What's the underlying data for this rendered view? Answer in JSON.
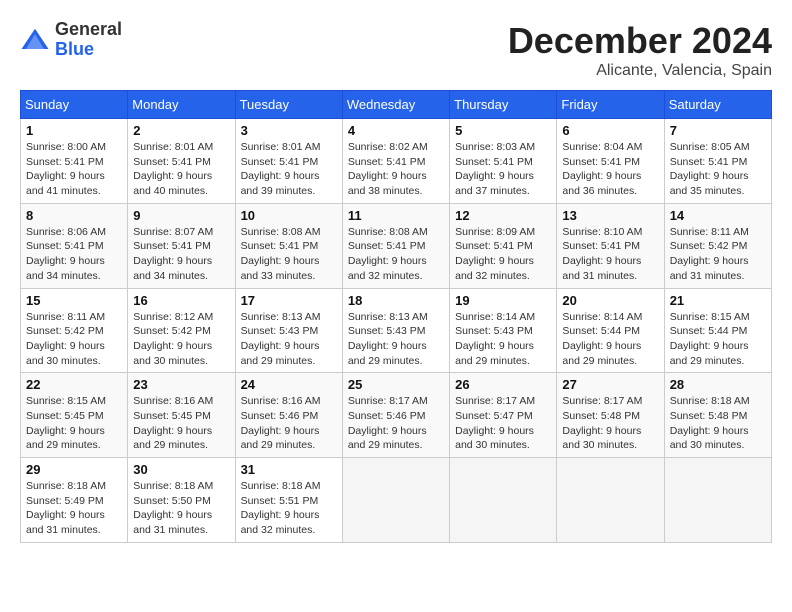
{
  "header": {
    "logo_general": "General",
    "logo_blue": "Blue",
    "month_title": "December 2024",
    "location": "Alicante, Valencia, Spain"
  },
  "calendar": {
    "days_of_week": [
      "Sunday",
      "Monday",
      "Tuesday",
      "Wednesday",
      "Thursday",
      "Friday",
      "Saturday"
    ],
    "weeks": [
      [
        {
          "day": "1",
          "sunrise": "Sunrise: 8:00 AM",
          "sunset": "Sunset: 5:41 PM",
          "daylight": "Daylight: 9 hours and 41 minutes."
        },
        {
          "day": "2",
          "sunrise": "Sunrise: 8:01 AM",
          "sunset": "Sunset: 5:41 PM",
          "daylight": "Daylight: 9 hours and 40 minutes."
        },
        {
          "day": "3",
          "sunrise": "Sunrise: 8:01 AM",
          "sunset": "Sunset: 5:41 PM",
          "daylight": "Daylight: 9 hours and 39 minutes."
        },
        {
          "day": "4",
          "sunrise": "Sunrise: 8:02 AM",
          "sunset": "Sunset: 5:41 PM",
          "daylight": "Daylight: 9 hours and 38 minutes."
        },
        {
          "day": "5",
          "sunrise": "Sunrise: 8:03 AM",
          "sunset": "Sunset: 5:41 PM",
          "daylight": "Daylight: 9 hours and 37 minutes."
        },
        {
          "day": "6",
          "sunrise": "Sunrise: 8:04 AM",
          "sunset": "Sunset: 5:41 PM",
          "daylight": "Daylight: 9 hours and 36 minutes."
        },
        {
          "day": "7",
          "sunrise": "Sunrise: 8:05 AM",
          "sunset": "Sunset: 5:41 PM",
          "daylight": "Daylight: 9 hours and 35 minutes."
        }
      ],
      [
        {
          "day": "8",
          "sunrise": "Sunrise: 8:06 AM",
          "sunset": "Sunset: 5:41 PM",
          "daylight": "Daylight: 9 hours and 34 minutes."
        },
        {
          "day": "9",
          "sunrise": "Sunrise: 8:07 AM",
          "sunset": "Sunset: 5:41 PM",
          "daylight": "Daylight: 9 hours and 34 minutes."
        },
        {
          "day": "10",
          "sunrise": "Sunrise: 8:08 AM",
          "sunset": "Sunset: 5:41 PM",
          "daylight": "Daylight: 9 hours and 33 minutes."
        },
        {
          "day": "11",
          "sunrise": "Sunrise: 8:08 AM",
          "sunset": "Sunset: 5:41 PM",
          "daylight": "Daylight: 9 hours and 32 minutes."
        },
        {
          "day": "12",
          "sunrise": "Sunrise: 8:09 AM",
          "sunset": "Sunset: 5:41 PM",
          "daylight": "Daylight: 9 hours and 32 minutes."
        },
        {
          "day": "13",
          "sunrise": "Sunrise: 8:10 AM",
          "sunset": "Sunset: 5:41 PM",
          "daylight": "Daylight: 9 hours and 31 minutes."
        },
        {
          "day": "14",
          "sunrise": "Sunrise: 8:11 AM",
          "sunset": "Sunset: 5:42 PM",
          "daylight": "Daylight: 9 hours and 31 minutes."
        }
      ],
      [
        {
          "day": "15",
          "sunrise": "Sunrise: 8:11 AM",
          "sunset": "Sunset: 5:42 PM",
          "daylight": "Daylight: 9 hours and 30 minutes."
        },
        {
          "day": "16",
          "sunrise": "Sunrise: 8:12 AM",
          "sunset": "Sunset: 5:42 PM",
          "daylight": "Daylight: 9 hours and 30 minutes."
        },
        {
          "day": "17",
          "sunrise": "Sunrise: 8:13 AM",
          "sunset": "Sunset: 5:43 PM",
          "daylight": "Daylight: 9 hours and 29 minutes."
        },
        {
          "day": "18",
          "sunrise": "Sunrise: 8:13 AM",
          "sunset": "Sunset: 5:43 PM",
          "daylight": "Daylight: 9 hours and 29 minutes."
        },
        {
          "day": "19",
          "sunrise": "Sunrise: 8:14 AM",
          "sunset": "Sunset: 5:43 PM",
          "daylight": "Daylight: 9 hours and 29 minutes."
        },
        {
          "day": "20",
          "sunrise": "Sunrise: 8:14 AM",
          "sunset": "Sunset: 5:44 PM",
          "daylight": "Daylight: 9 hours and 29 minutes."
        },
        {
          "day": "21",
          "sunrise": "Sunrise: 8:15 AM",
          "sunset": "Sunset: 5:44 PM",
          "daylight": "Daylight: 9 hours and 29 minutes."
        }
      ],
      [
        {
          "day": "22",
          "sunrise": "Sunrise: 8:15 AM",
          "sunset": "Sunset: 5:45 PM",
          "daylight": "Daylight: 9 hours and 29 minutes."
        },
        {
          "day": "23",
          "sunrise": "Sunrise: 8:16 AM",
          "sunset": "Sunset: 5:45 PM",
          "daylight": "Daylight: 9 hours and 29 minutes."
        },
        {
          "day": "24",
          "sunrise": "Sunrise: 8:16 AM",
          "sunset": "Sunset: 5:46 PM",
          "daylight": "Daylight: 9 hours and 29 minutes."
        },
        {
          "day": "25",
          "sunrise": "Sunrise: 8:17 AM",
          "sunset": "Sunset: 5:46 PM",
          "daylight": "Daylight: 9 hours and 29 minutes."
        },
        {
          "day": "26",
          "sunrise": "Sunrise: 8:17 AM",
          "sunset": "Sunset: 5:47 PM",
          "daylight": "Daylight: 9 hours and 30 minutes."
        },
        {
          "day": "27",
          "sunrise": "Sunrise: 8:17 AM",
          "sunset": "Sunset: 5:48 PM",
          "daylight": "Daylight: 9 hours and 30 minutes."
        },
        {
          "day": "28",
          "sunrise": "Sunrise: 8:18 AM",
          "sunset": "Sunset: 5:48 PM",
          "daylight": "Daylight: 9 hours and 30 minutes."
        }
      ],
      [
        {
          "day": "29",
          "sunrise": "Sunrise: 8:18 AM",
          "sunset": "Sunset: 5:49 PM",
          "daylight": "Daylight: 9 hours and 31 minutes."
        },
        {
          "day": "30",
          "sunrise": "Sunrise: 8:18 AM",
          "sunset": "Sunset: 5:50 PM",
          "daylight": "Daylight: 9 hours and 31 minutes."
        },
        {
          "day": "31",
          "sunrise": "Sunrise: 8:18 AM",
          "sunset": "Sunset: 5:51 PM",
          "daylight": "Daylight: 9 hours and 32 minutes."
        },
        null,
        null,
        null,
        null
      ]
    ]
  }
}
